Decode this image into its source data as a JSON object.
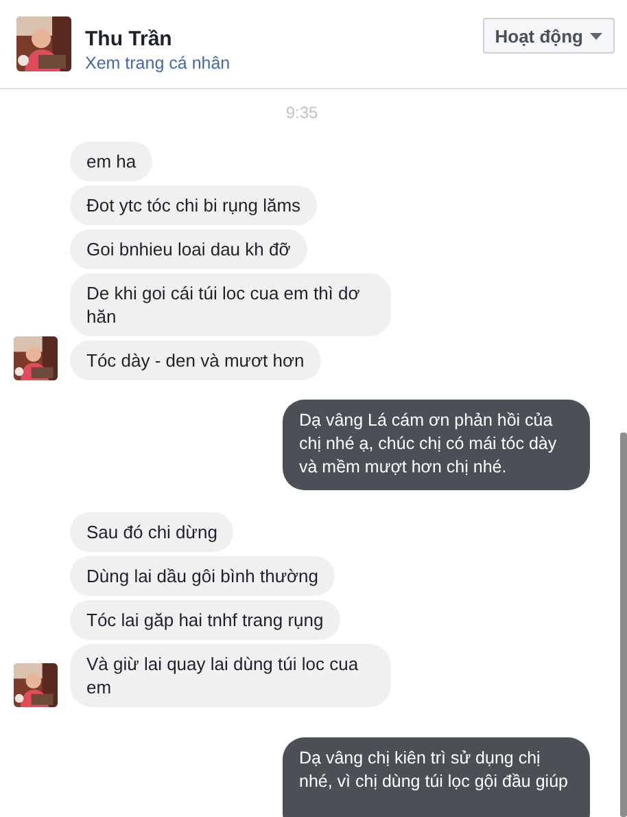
{
  "header": {
    "name": "Thu Trần",
    "profile_link": "Xem trang cá nhân",
    "status_button": "Hoạt động"
  },
  "time": "9:35",
  "groups": [
    {
      "kind": "them",
      "messages": [
        "em ha",
        "Đot ytc tóc chi bi rụng lăms",
        "Goi bnhieu loai dau kh  đỡ",
        "De khi goi cái túi loc cua em thì dơ hăn",
        "Tóc dày - den và mươt hơn"
      ]
    },
    {
      "kind": "me",
      "messages": [
        "Dạ vâng Lá cám ơn phản hồi của chị nhé ạ, chúc chị có mái tóc dày và mềm mượt hơn chị nhé."
      ]
    },
    {
      "kind": "them",
      "messages": [
        "Sau đó chi dừng",
        "Dùng lai dầu gôi bình thường",
        "Tóc lai găp hai tnhf trang rụng",
        "Và giừ lai quay lai dùng túi loc cua em"
      ]
    },
    {
      "kind": "me",
      "messages": [
        "Dạ vâng chị kiên trì sử dụng chị nhé, vì chị dùng túi lọc gội đầu giúp"
      ]
    }
  ]
}
